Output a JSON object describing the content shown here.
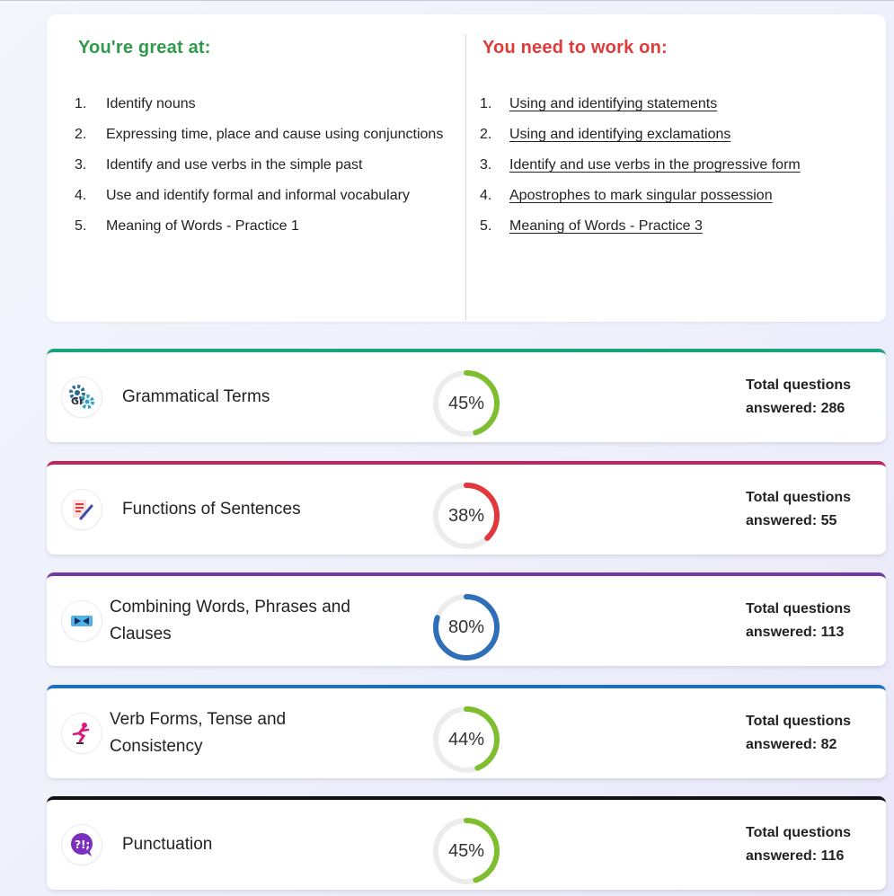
{
  "great_at": {
    "heading": "You're great at:",
    "items": [
      {
        "num": "1.",
        "text": "Identify nouns"
      },
      {
        "num": "2.",
        "text": "Expressing time, place and cause using conjunctions"
      },
      {
        "num": "3.",
        "text": "Identify and use verbs in the simple past"
      },
      {
        "num": "4.",
        "text": "Use and identify formal and informal vocabulary"
      },
      {
        "num": "5.",
        "text": "Meaning of Words - Practice 1"
      }
    ]
  },
  "work_on": {
    "heading": "You need to work on:",
    "items": [
      {
        "num": "1.",
        "text": "Using and identifying statements"
      },
      {
        "num": "2.",
        "text": "Using and identifying exclamations"
      },
      {
        "num": "3.",
        "text": "Identify and use verbs in the progressive form"
      },
      {
        "num": "4.",
        "text": "Apostrophes to mark singular possession"
      },
      {
        "num": "5.",
        "text": "Meaning of Words - Practice 3"
      }
    ]
  },
  "total_label": "Total questions",
  "answered_prefix": "answered:",
  "topics": [
    {
      "title": "Grammatical Terms",
      "percent_label": "45%",
      "percent": 45,
      "answered": "286",
      "accent": "#1aa37a",
      "ring_color": "#7fbf2f",
      "icon": "gears-icon"
    },
    {
      "title": "Functions of Sentences",
      "percent_label": "38%",
      "percent": 38,
      "answered": "55",
      "accent": "#c0265e",
      "ring_color": "#e0383d",
      "icon": "document-pencil-icon"
    },
    {
      "title": "Combining Words, Phrases and Clauses",
      "percent_label": "80%",
      "percent": 80,
      "answered": "113",
      "accent": "#6f3aa8",
      "ring_color": "#2f6fb8",
      "icon": "bow-tie-icon"
    },
    {
      "title": "Verb Forms, Tense and Consistency",
      "percent_label": "44%",
      "percent": 44,
      "answered": "82",
      "accent": "#1f6fbf",
      "ring_color": "#7fbf2f",
      "icon": "skater-icon"
    },
    {
      "title": "Punctuation",
      "percent_label": "45%",
      "percent": 45,
      "answered": "116",
      "accent": "#111111",
      "ring_color": "#7fbf2f",
      "icon": "punctuation-bubble-icon"
    }
  ]
}
